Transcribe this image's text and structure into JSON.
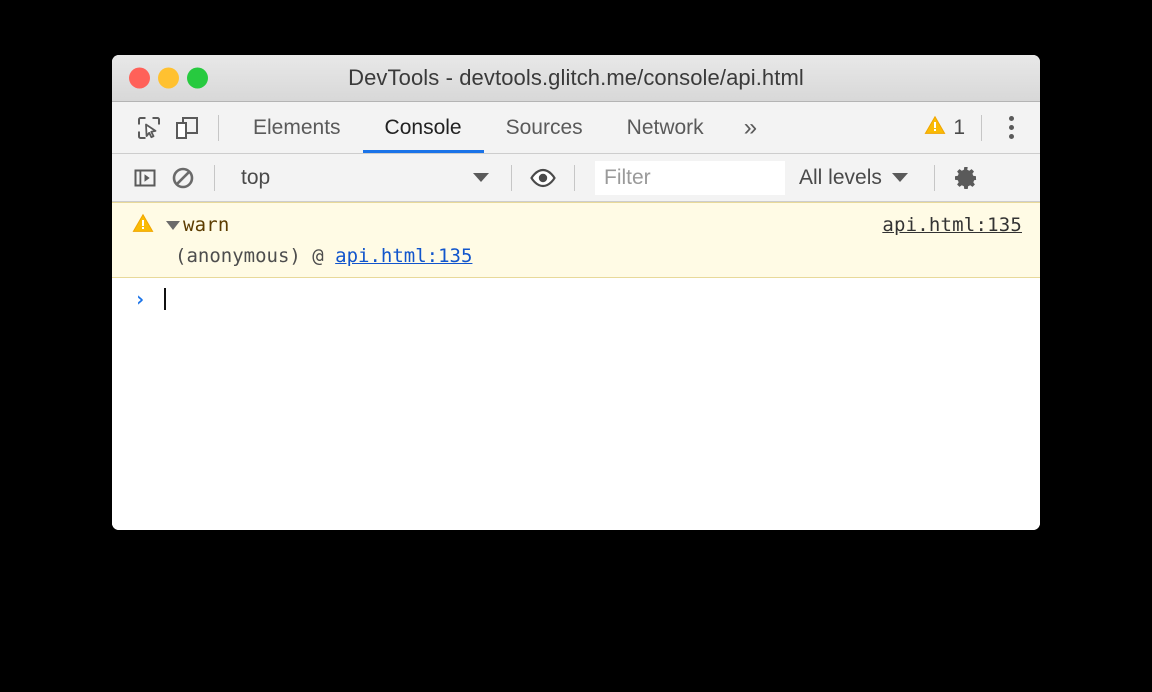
{
  "window": {
    "title": "DevTools - devtools.glitch.me/console/api.html",
    "traffic_lights": [
      {
        "name": "close",
        "color": "#ff6159"
      },
      {
        "name": "minimize",
        "color": "#ffc130"
      },
      {
        "name": "maximize",
        "color": "#27ca3f"
      }
    ]
  },
  "tabbar": {
    "inspect_icon": "inspect-element-icon",
    "device_icon": "device-toolbar-icon",
    "tabs": [
      {
        "label": "Elements",
        "active": false
      },
      {
        "label": "Console",
        "active": true
      },
      {
        "label": "Sources",
        "active": false
      },
      {
        "label": "Network",
        "active": false
      }
    ],
    "overflow_label": "»",
    "warning_icon": "warning-triangle-icon",
    "warning_count": "1",
    "menu_icon": "vertical-dots-icon",
    "active_tab_color": "#1a73e8"
  },
  "console_toolbar": {
    "sidebar_toggle_icon": "show-console-sidebar-icon",
    "clear_icon": "clear-console-icon",
    "context": {
      "value": "top",
      "caret_icon": "chevron-down-icon"
    },
    "eye_icon": "live-expression-eye-icon",
    "filter": {
      "value": "",
      "placeholder": "Filter"
    },
    "levels": {
      "label": "All levels",
      "caret_icon": "chevron-down-icon"
    },
    "settings_icon": "gear-icon"
  },
  "console": {
    "messages": [
      {
        "level": "warning",
        "icon": "warning-triangle-icon",
        "disclosure_icon": "triangle-down-icon",
        "text": "warn",
        "source_link": "api.html:135",
        "stack": {
          "prefix": "(anonymous) @ ",
          "link": "api.html:135"
        },
        "background_color": "#fffbe5",
        "border_color": "#e8d99a"
      }
    ],
    "prompt": {
      "arrow": "›",
      "input_value": ""
    }
  }
}
